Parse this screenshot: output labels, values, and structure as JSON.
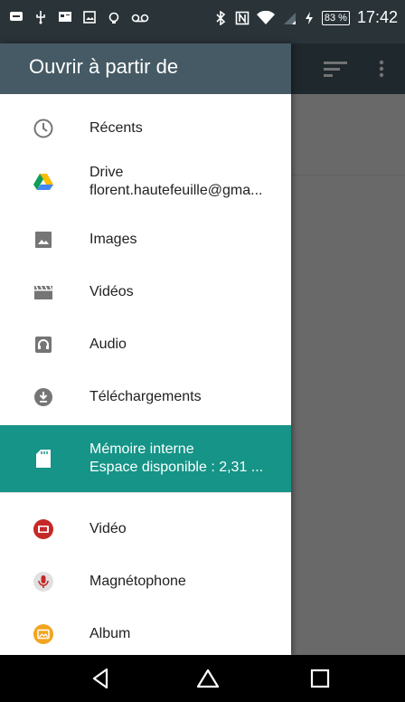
{
  "status_bar": {
    "battery_percent": "83 %",
    "time": "17:42"
  },
  "drawer": {
    "title": "Ouvrir à partir de",
    "items": [
      {
        "label": "Récents",
        "icon": "clock-icon"
      },
      {
        "label": "Drive",
        "sublabel": "florent.hautefeuille@gma...",
        "icon": "google-drive-icon"
      },
      {
        "label": "Images",
        "icon": "image-icon"
      },
      {
        "label": "Vidéos",
        "icon": "video-clapper-icon"
      },
      {
        "label": "Audio",
        "icon": "headphones-icon"
      },
      {
        "label": "Téléchargements",
        "icon": "download-icon"
      },
      {
        "label": "Mémoire interne",
        "sublabel": "Espace disponible : 2,31 ...",
        "icon": "sd-card-icon",
        "selected": true
      },
      {
        "label": "Vidéo",
        "icon": "video-app-icon"
      },
      {
        "label": "Magnétophone",
        "icon": "microphone-icon"
      },
      {
        "label": "Album",
        "icon": "album-icon"
      }
    ]
  },
  "colors": {
    "status_bar": "#293338",
    "toolbar": "#455a64",
    "selected": "#159487"
  }
}
